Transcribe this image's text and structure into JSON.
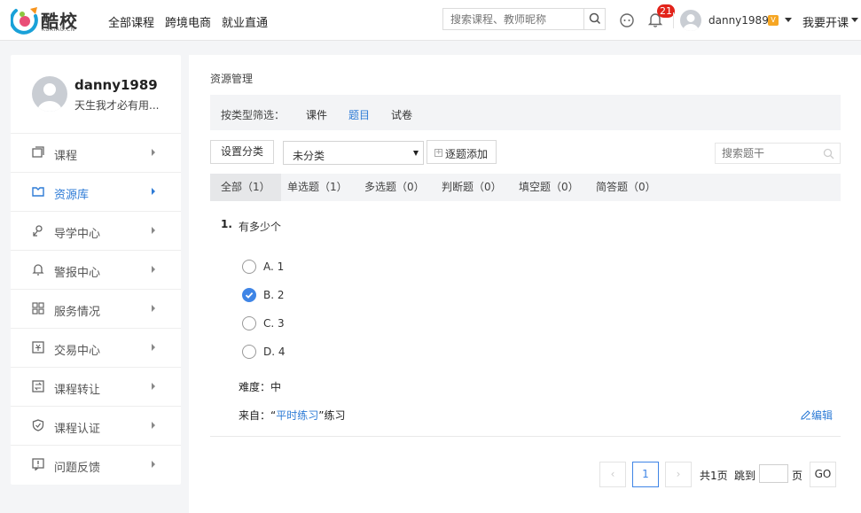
{
  "brand": {
    "name": "酷校",
    "sub": "KUXIAO.CN"
  },
  "nav": [
    "全部课程",
    "跨境电商",
    "就业直通"
  ],
  "search": {
    "placeholder": "搜索课程、教师昵称"
  },
  "notifications": {
    "count": "21"
  },
  "user": {
    "name": "danny1989",
    "vip": "V",
    "signature": "天生我才必有用..."
  },
  "teach_label": "我要开课",
  "sidebar": {
    "items": [
      {
        "label": "课程",
        "icon": "course-icon"
      },
      {
        "label": "资源库",
        "icon": "library-icon",
        "active": true
      },
      {
        "label": "导学中心",
        "icon": "guide-icon"
      },
      {
        "label": "警报中心",
        "icon": "alert-icon"
      },
      {
        "label": "服务情况",
        "icon": "service-icon"
      },
      {
        "label": "交易中心",
        "icon": "trade-icon"
      },
      {
        "label": "课程转让",
        "icon": "transfer-icon"
      },
      {
        "label": "课程认证",
        "icon": "certify-icon"
      },
      {
        "label": "问题反馈",
        "icon": "feedback-icon"
      }
    ]
  },
  "main": {
    "breadcrumb": "资源管理",
    "filter": {
      "label": "按类型筛选：",
      "options": [
        "课件",
        "题目",
        "试卷"
      ],
      "selected": "题目"
    },
    "toolbar": {
      "set_category": "设置分类",
      "category_value": "未分类",
      "add_label": "逐题添加",
      "search_placeholder": "搜索题干"
    },
    "tabs": [
      "全部（1）",
      "单选题（1）",
      "多选题（0）",
      "判断题（0）",
      "填空题（0）",
      "简答题（0）"
    ],
    "question": {
      "number": "1.",
      "text": "有多少个",
      "options": [
        {
          "label": "A.  1",
          "checked": false
        },
        {
          "label": "B.  2",
          "checked": true
        },
        {
          "label": "C.  3",
          "checked": false
        },
        {
          "label": "D.  4",
          "checked": false
        }
      ],
      "difficulty": "难度：中",
      "source_prefix": "来自：“",
      "source_link": "平时练习",
      "source_suffix": "”练习",
      "edit": "编辑"
    },
    "pagination": {
      "current": "1",
      "total": "共1页",
      "jump": "跳到",
      "unit": "页",
      "go": "GO",
      "prev": "‹",
      "next": "›"
    }
  },
  "colors": {
    "accent": "#2d7bd6",
    "badge": "#e2231a"
  }
}
